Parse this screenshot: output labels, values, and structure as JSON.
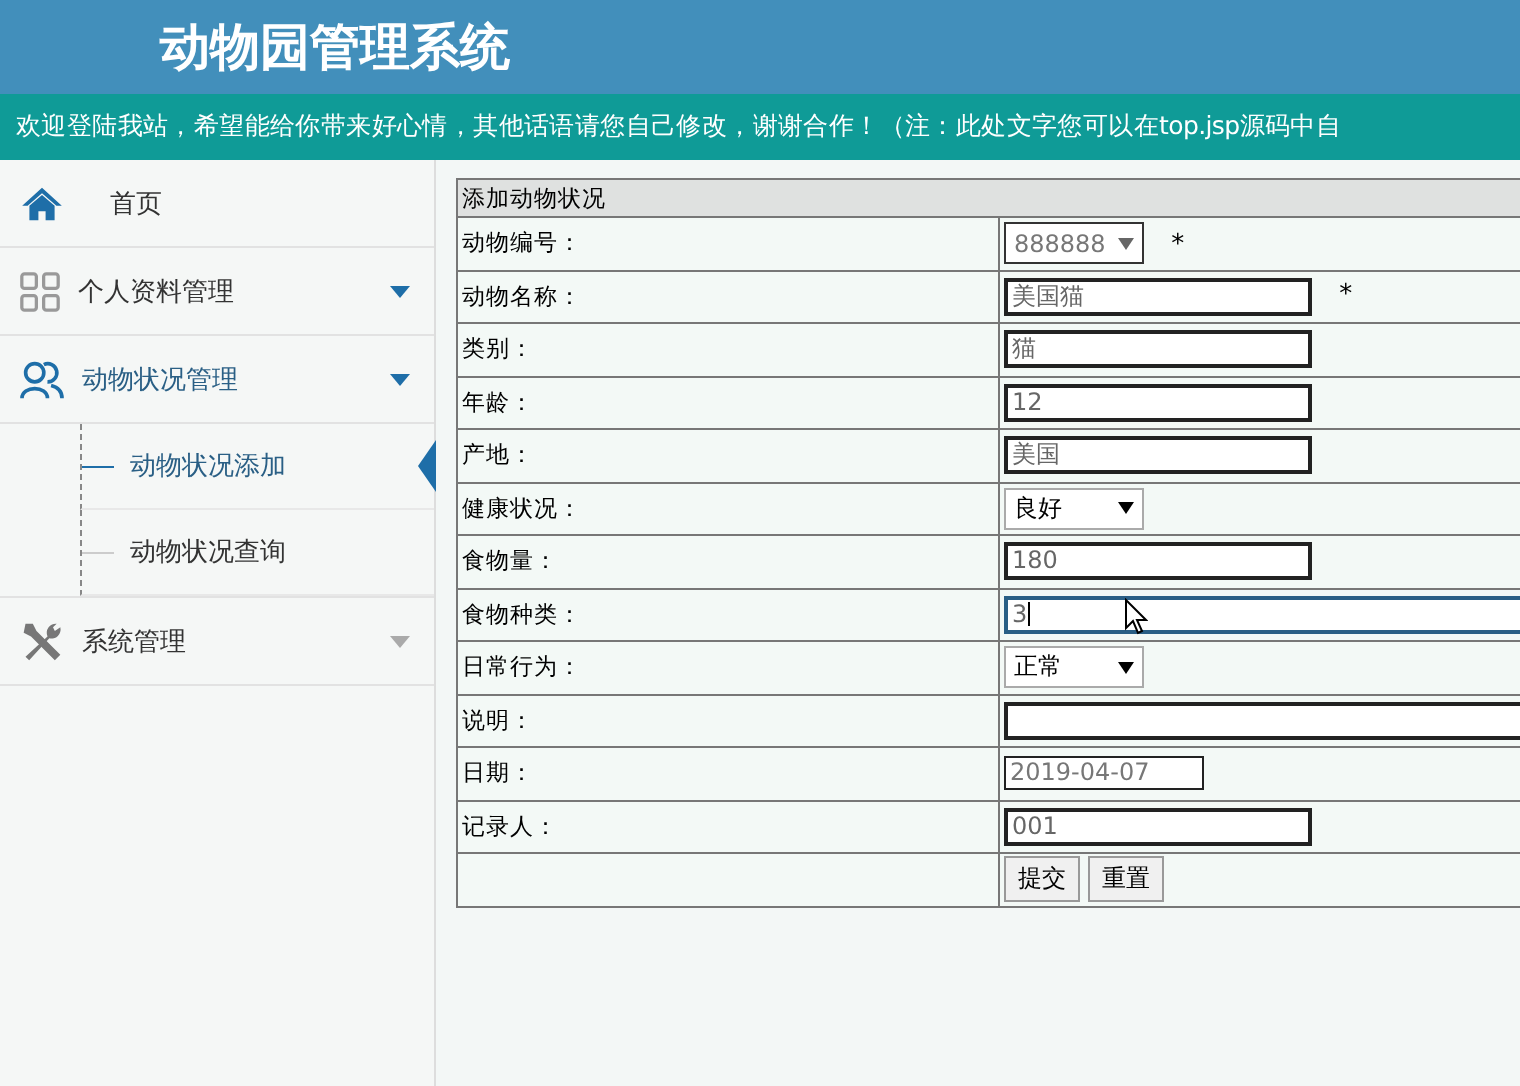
{
  "header": {
    "title": "动物园管理系统",
    "notice": "欢迎登陆我站，希望能给你带来好心情，其他话语请您自己修改，谢谢合作！（注：此处文字您可以在top.jsp源码中自"
  },
  "sidebar": {
    "items": [
      {
        "label": "首页"
      },
      {
        "label": "个人资料管理",
        "expanded": false
      },
      {
        "label": "动物状况管理",
        "expanded": true,
        "children": [
          {
            "label": "动物状况添加",
            "selected": true
          },
          {
            "label": "动物状况查询",
            "selected": false
          }
        ]
      },
      {
        "label": "系统管理",
        "expanded": false
      }
    ]
  },
  "form": {
    "title": "添加动物状况",
    "fields": [
      {
        "label": "动物编号：",
        "kind": "select",
        "value": "888888",
        "required": true,
        "focused": false
      },
      {
        "label": "动物名称：",
        "kind": "input",
        "value": "美国猫",
        "required": true,
        "focused": false
      },
      {
        "label": "类别：",
        "kind": "input",
        "value": "猫",
        "required": false,
        "focused": false
      },
      {
        "label": "年龄：",
        "kind": "input",
        "value": "12",
        "required": false,
        "focused": false
      },
      {
        "label": "产地：",
        "kind": "input",
        "value": "美国",
        "required": false,
        "focused": false
      },
      {
        "label": "健康状况：",
        "kind": "select",
        "value": "良好",
        "required": false,
        "focused": false
      },
      {
        "label": "食物量：",
        "kind": "input",
        "value": "180",
        "required": false,
        "focused": false
      },
      {
        "label": "食物种类：",
        "kind": "wide",
        "value": "3",
        "required": false,
        "focused": true
      },
      {
        "label": "日常行为：",
        "kind": "select",
        "value": "正常",
        "required": false,
        "focused": false
      },
      {
        "label": "说明：",
        "kind": "wide",
        "required": false,
        "focused": false
      },
      {
        "label": "日期：",
        "kind": "date",
        "value": "2019-04-07",
        "required": false,
        "focused": false
      },
      {
        "label": "记录人：",
        "kind": "input",
        "value": "001",
        "required": false,
        "focused": false
      }
    ],
    "required_mark": "*",
    "buttons": [
      "提交",
      "重置"
    ]
  }
}
